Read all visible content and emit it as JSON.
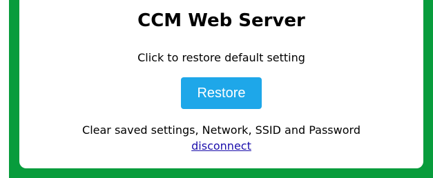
{
  "header": {
    "title": "CCM Web Server"
  },
  "restore": {
    "prompt": "Click to restore default setting",
    "button_label": "Restore"
  },
  "info": {
    "text": "Clear saved settings, Network, SSID and Password",
    "link_label": "disconnect"
  },
  "colors": {
    "frame_green": "#089c3c",
    "button_blue": "#1ea7e9",
    "link": "#1a0dab"
  }
}
